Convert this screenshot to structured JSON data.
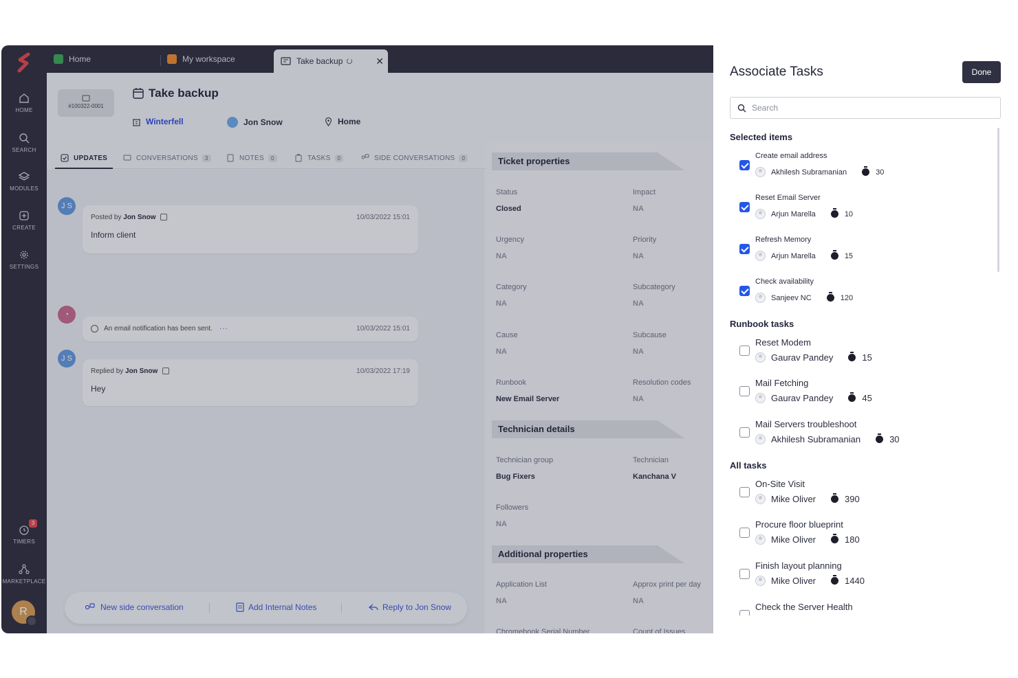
{
  "app": {
    "tabs": [
      {
        "label": "Home",
        "color": "#3aa354"
      },
      {
        "label": "My workspace",
        "color": "#e88a2e"
      },
      {
        "label": "Take backup"
      }
    ],
    "rail": [
      {
        "label": "HOME",
        "icon": "home-icon"
      },
      {
        "label": "SEARCH",
        "icon": "search-icon"
      },
      {
        "label": "MODULES",
        "icon": "layers-icon"
      },
      {
        "label": "CREATE",
        "icon": "plus-square-icon"
      },
      {
        "label": "SETTINGS",
        "icon": "gear-icon"
      },
      {
        "label": "TIMERS",
        "icon": "timer-icon",
        "badge": "3"
      },
      {
        "label": "MARKETPLACE",
        "icon": "marketplace-icon"
      }
    ],
    "user_initial": "R",
    "ticket": {
      "id": "#100322-0001",
      "title": "Take backup",
      "site": "Winterfell",
      "requester": "Jon Snow",
      "location": "Home"
    },
    "subtabs": [
      {
        "label": "UPDATES",
        "count": ""
      },
      {
        "label": "CONVERSATIONS",
        "count": "3"
      },
      {
        "label": "NOTES",
        "count": "0"
      },
      {
        "label": "TASKS",
        "count": "0"
      },
      {
        "label": "SIDE CONVERSATIONS",
        "count": "0"
      }
    ],
    "feed": [
      {
        "initials": "J S",
        "prefix": "Posted by",
        "author": "Jon Snow",
        "time": "10/03/2022 15:01",
        "body": "Inform client"
      },
      {
        "text": "An email notification has been sent.",
        "time": "10/03/2022 15:01"
      },
      {
        "initials": "J S",
        "prefix": "Replied by",
        "author": "Jon Snow",
        "time": "10/03/2022 17:19",
        "body": "Hey"
      }
    ],
    "actions": {
      "side_conversation": "New side conversation",
      "internal_notes": "Add Internal Notes",
      "reply": "Reply to Jon Snow"
    },
    "props": {
      "ticket_title": "Ticket properties",
      "ticket": [
        {
          "label": "Status",
          "value": "Closed",
          "dark": true
        },
        {
          "label": "Impact",
          "value": "NA"
        },
        {
          "label": "Urgency",
          "value": "NA"
        },
        {
          "label": "Priority",
          "value": "NA"
        },
        {
          "label": "Category",
          "value": "NA"
        },
        {
          "label": "Subcategory",
          "value": "NA"
        },
        {
          "label": "Cause",
          "value": "NA"
        },
        {
          "label": "Subcause",
          "value": "NA"
        },
        {
          "label": "Runbook",
          "value": "New Email Server",
          "dark": true
        },
        {
          "label": "Resolution codes",
          "value": "NA"
        }
      ],
      "tech_title": "Technician details",
      "tech": [
        {
          "label": "Technician group",
          "value": "Bug Fixers",
          "dark": true
        },
        {
          "label": "Technician",
          "value": "Kanchana V",
          "dark": true
        },
        {
          "label": "Followers",
          "value": "NA"
        }
      ],
      "add_title": "Additional properties",
      "additional": [
        {
          "label": "Application List",
          "value": "NA"
        },
        {
          "label": "Approx print per day",
          "value": "NA"
        },
        {
          "label": "Chromebook Serial Number",
          "value": ""
        },
        {
          "label": "Count of Issues",
          "value": ""
        }
      ]
    }
  },
  "panel": {
    "title": "Associate Tasks",
    "done_label": "Done",
    "search_placeholder": "Search",
    "selected_title": "Selected items",
    "selected": [
      {
        "name": "Create email address",
        "assignee": "Akhilesh Subramanian",
        "time": "30",
        "checked": true
      },
      {
        "name": "Reset Email Server",
        "assignee": "Arjun Marella",
        "time": "10",
        "checked": true
      },
      {
        "name": "Refresh Memory",
        "assignee": "Arjun Marella",
        "time": "15",
        "checked": true
      },
      {
        "name": "Check availability",
        "assignee": "Sanjeev NC",
        "time": "120",
        "checked": true
      }
    ],
    "runbook_title": "Runbook tasks",
    "runbook": [
      {
        "name": "Reset Modem",
        "assignee": "Gaurav Pandey",
        "time": "15",
        "checked": false
      },
      {
        "name": "Mail Fetching",
        "assignee": "Gaurav Pandey",
        "time": "45",
        "checked": false
      },
      {
        "name": "Mail Servers troubleshoot",
        "assignee": "Akhilesh Subramanian",
        "time": "30",
        "checked": false
      }
    ],
    "all_title": "All tasks",
    "all": [
      {
        "name": "On-Site Visit",
        "assignee": "Mike Oliver",
        "time": "390",
        "checked": false
      },
      {
        "name": "Procure floor blueprint",
        "assignee": "Mike Oliver",
        "time": "180",
        "checked": false
      },
      {
        "name": "Finish layout planning",
        "assignee": "Mike Oliver",
        "time": "1440",
        "checked": false
      },
      {
        "name": "Check the Server Health",
        "assignee": "",
        "time": "",
        "checked": false
      }
    ]
  }
}
